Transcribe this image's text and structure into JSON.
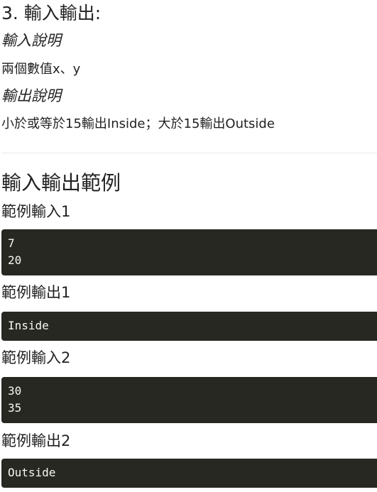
{
  "section": {
    "heading": "3. 輸入輸出:",
    "input_desc_title": "輸入說明",
    "input_desc_text": "兩個數值x、y",
    "output_desc_title": "輸出說明",
    "output_desc_text": "小於或等於15輸出Inside；大於15輸出Outside"
  },
  "examples": {
    "heading": "輸入輸出範例",
    "items": [
      {
        "label": "範例輸入1",
        "code": "7\n20"
      },
      {
        "label": "範例輸出1",
        "code": "Inside"
      },
      {
        "label": "範例輸入2",
        "code": "30\n35"
      },
      {
        "label": "範例輸出2",
        "code": "Outside"
      }
    ]
  }
}
